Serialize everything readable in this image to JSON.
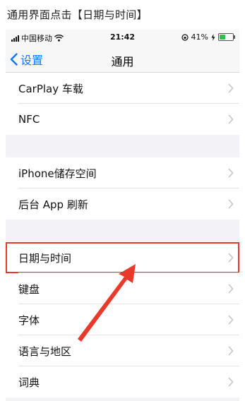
{
  "caption": "通用界面点击【日期与时间】",
  "status_bar": {
    "carrier": "中国移动",
    "time": "21:42",
    "battery_percent": "41%",
    "battery_level": 0.41
  },
  "nav": {
    "back_label": "设置",
    "title": "通用"
  },
  "groups": [
    {
      "items": [
        "CarPlay 车载",
        "NFC"
      ]
    },
    {
      "items": [
        "iPhone储存空间",
        "后台 App 刷新"
      ]
    },
    {
      "items": [
        "日期与时间",
        "键盘",
        "字体",
        "语言与地区",
        "词典"
      ]
    }
  ],
  "highlighted_item": "日期与时间",
  "colors": {
    "accent": "#0a7aff",
    "highlight_border": "#e8392b",
    "arrow": "#e8392b"
  },
  "icons": {
    "back": "chevron-left-icon",
    "wifi": "wifi-icon",
    "rotation_lock": "rotation-lock-icon",
    "charging": "bolt-icon",
    "disclosure": "chevron-right-icon"
  }
}
